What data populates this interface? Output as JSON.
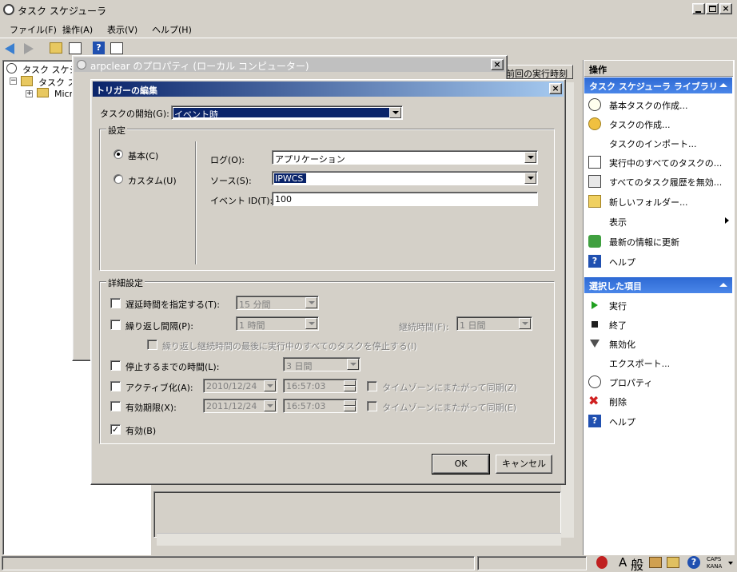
{
  "app": {
    "title": "タスク スケジューラ",
    "menu": [
      "ファイル(F)",
      "操作(A)",
      "表示(V)",
      "ヘルプ(H)"
    ],
    "tree": {
      "root": "タスク スケジューラ",
      "library": "タスク スケジューラ ライブラリ",
      "folder": "Microsoft"
    },
    "column_header": "前回の実行時刻"
  },
  "properties_dialog": {
    "title": "arpclear のプロパティ (ローカル コンピューター)"
  },
  "trigger_dialog": {
    "title": "トリガーの編集",
    "begin_label": "タスクの開始(G):",
    "begin_value": "イベント時",
    "settings_group": "設定",
    "radio_basic": "基本(C)",
    "radio_custom": "カスタム(U)",
    "log_label": "ログ(O):",
    "log_value": "アプリケーション",
    "source_label": "ソース(S):",
    "source_value": "IPWCS",
    "event_id_label": "イベント ID(T):",
    "event_id_value": "100",
    "advanced_group": "詳細設定",
    "delay_label": "遅延時間を指定する(T):",
    "delay_value": "15 分間",
    "repeat_label": "繰り返し間隔(P):",
    "repeat_value": "1 時間",
    "duration_label": "継続時間(F):",
    "duration_value": "1 日間",
    "stop_all_label": "繰り返し継続時間の最後に実行中のすべてのタスクを停止する(I)",
    "stop_after_label": "停止するまでの時間(L):",
    "stop_after_value": "3 日間",
    "activate_label": "アクティブ化(A):",
    "activate_date": "2010/12/24",
    "activate_time": "16:57:03",
    "expire_label": "有効期限(X):",
    "expire_date": "2011/12/24",
    "expire_time": "16:57:03",
    "sync_tz_label_1": "タイムゾーンにまたがって同期(Z)",
    "sync_tz_label_2": "タイムゾーンにまたがって同期(E)",
    "enabled_label": "有効(B)",
    "ok_label": "OK",
    "cancel_label": "キャンセル"
  },
  "actions_pane": {
    "header": "操作",
    "section1": "タスク スケジューラ ライブラリ",
    "items1": [
      "基本タスクの作成...",
      "タスクの作成...",
      "タスクのインポート...",
      "実行中のすべてのタスクの...",
      "すべてのタスク履歴を無効...",
      "新しいフォルダー...",
      "表示",
      "最新の情報に更新",
      "ヘルプ"
    ],
    "section2": "選択した項目",
    "items2": [
      "実行",
      "終了",
      "無効化",
      "エクスポート...",
      "プロパティ",
      "削除",
      "ヘルプ"
    ]
  },
  "taskbar": {
    "ime_a": "A",
    "ime_mode": "般",
    "caps": "CAPS",
    "kana": "KANA"
  },
  "colors": {
    "selection": "#0a246a",
    "active_title": "#0a246a",
    "section_header": "#2e6ad4"
  }
}
